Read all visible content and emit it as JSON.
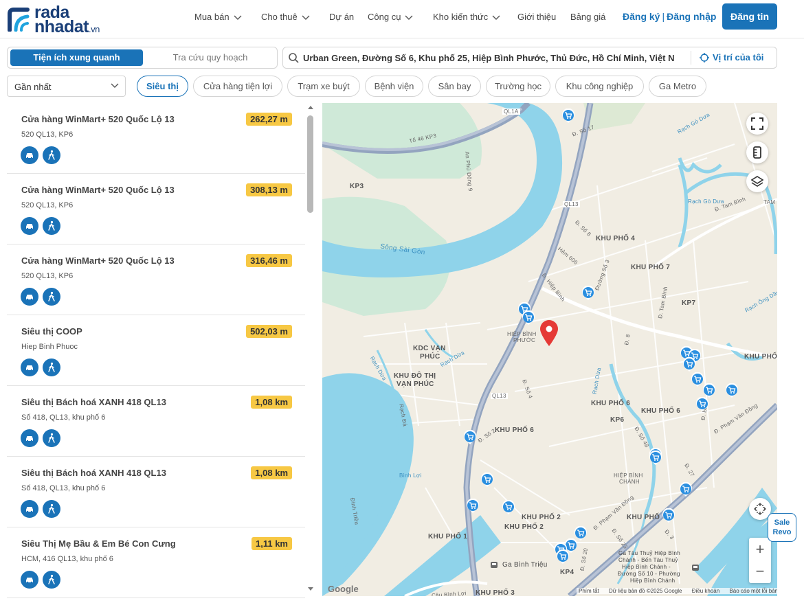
{
  "header": {
    "logo_line1": "rada",
    "logo_line2": "nhadat",
    "logo_suffix": ".vn",
    "nav": [
      "Mua bán",
      "Cho thuê",
      "Dự án",
      "Công cụ",
      "Kho kiến thức",
      "Giới thiệu",
      "Bảng giá"
    ],
    "register": "Đăng ký",
    "login": "Đăng nhập",
    "post_button": "Đăng tin"
  },
  "toolbar": {
    "tab_active": "Tiện ích xung quanh",
    "tab_inactive": "Tra cứu quy hoạch",
    "search_value": "Urban Green, Đường Số 6, Khu phố 25, Hiệp Bình Phước, Thủ Đức, Hồ Chí Minh, Việt N",
    "my_location": "Vị trí của tôi",
    "sort_value": "Gần nhất",
    "categories": [
      "Siêu thị",
      "Cửa hàng tiện lợi",
      "Trạm xe buýt",
      "Bệnh viện",
      "Sân bay",
      "Trường học",
      "Khu công nghiệp",
      "Ga Metro"
    ],
    "active_category": "Siêu thị"
  },
  "places": [
    {
      "name": "Cửa hàng WinMart+ 520 Quốc Lộ 13",
      "address": "520 QL13, KP6",
      "distance": "262,27 m"
    },
    {
      "name": "Cửa hàng WinMart+ 520 Quốc Lộ 13",
      "address": "520 QL13, KP6",
      "distance": "308,13 m"
    },
    {
      "name": "Cửa hàng WinMart+ 520 Quốc Lộ 13",
      "address": "520 QL13, KP6",
      "distance": "316,46 m"
    },
    {
      "name": "Siêu thị COOP",
      "address": "Hiep Binh Phuoc",
      "distance": "502,03 m"
    },
    {
      "name": "Siêu thị Bách hoá XANH 418 QL13",
      "address": "Số 418, QL13, khu phố 6",
      "distance": "1,08 km"
    },
    {
      "name": "Siêu thị Bách hoá XANH 418 QL13",
      "address": "Số 418, QL13, khu phố 6",
      "distance": "1,08 km"
    },
    {
      "name": "Siêu Thị Mẹ Bầu & Em Bé Con Cưng",
      "address": "HCM, 416 QL13, khu phố 6",
      "distance": "1,11 km"
    }
  ],
  "map": {
    "labels": {
      "kp3": "KP3",
      "song_sai_gon": "Sông Sài Gòn",
      "kdc_van_phuc_1": "KDC VẠN",
      "kdc_van_phuc_2": "PHÚC",
      "kdt_van_phuc_1": "KHU ĐÔ THỊ",
      "kdt_van_phuc_2": "VẠN PHÚC",
      "hiep_binh_phuoc_1": "HIỆP BÌNH",
      "hiep_binh_phuoc_2": "PHƯỚC",
      "kp4": "KHU PHỐ 4",
      "kp7": "KHU PHỐ 7",
      "kp7b": "KP7",
      "kp6a": "KHU PHỐ 6",
      "kp6b": "KHU PHỐ 6",
      "kp6c": "KP6",
      "kp6d": "KHU PHỐ 6",
      "kp_right": "KHU PHỐ",
      "kp2a": "KHU PHỐ 2",
      "kp2b": "KHU PHỐ 2",
      "kp1": "KHU PHỐ 1",
      "kp3b": "KHU PHỐ 3",
      "kp4b": "KP4",
      "kp_right2": "KHU PHỐ",
      "hiep_binh_chanh_1": "HIỆP BÌNH",
      "hiep_binh_chanh_2": "CHÁNH",
      "ga_binh_trieu": "Ga Bình Triệu",
      "ga_tau_1": "Ga Tàu Thuỷ Hiệp Bình",
      "ga_tau_2": "Chánh - Bến Tàu Thuỷ",
      "ga_tau_3": "Hiệp Bình Chánh -",
      "ga_tau_4": "Đường Số 10 - Phường",
      "ga_tau_5": "Hiệp Bình Chánh",
      "ql13_a": "QL13",
      "ql13_b": "QL13",
      "ql1a": "QL1A",
      "d_hiep_binh": "Đ. Hiệp Bình",
      "d_pham_van_dong_1": "Đ. Phạm Văn Đồng",
      "d_pham_van_dong_2": "Đ. Phạm Văn Đồng",
      "d_tam_binh": "Đ. Tam Bình",
      "d_tam_binh2": "Đ. Tam Bình",
      "an_phu_dong_9": "An Phú Đông 9",
      "to_46": "Tổ 46 KP3",
      "hem_606": "Hẻm 606",
      "duong_so_3": "Đường Số 3",
      "d_so_17": "Đ. Số 17",
      "d_so_8": "Đ. Số 8",
      "d_so_4": "Đ. Số 4",
      "d_so_2": "Đ. Số 2",
      "d_so_48": "Đ. Số 48",
      "d_so_27": "Đ. 27",
      "d_so_23": "Đ. Số 23",
      "d_so_20": "Đ. Số 20",
      "d_so_3b": "Đ. 3",
      "d_binh": "Đ. Bình",
      "d_8": "Đ. 8",
      "rach_da": "Rạch Đá",
      "rach_dua": "Rạch Dừa",
      "rach_dua2": "Rạch Dừa",
      "rach_dua3": "Rạch Dừa",
      "rach_go_dua": "Rạch Gò Dưa",
      "rach_go_dua2": "Rạch Gò Dưa",
      "rach_ong_dau": "Rạch Ông Dầu",
      "binh_loi": "Bình Lợi",
      "dinh_trieu": "Đình Triều",
      "cau_binh_loi": "Cầu Bình Lợi",
      "tam": "TAM"
    },
    "footer": {
      "shortcuts": "Phím tắt",
      "data": "Dữ liệu bản đồ ©2025 Google",
      "terms": "Điều khoản",
      "report": "Báo cáo một lỗi bản đồ"
    },
    "google": "Google"
  },
  "sale_badge": {
    "line1": "Sale",
    "line2": "Revo"
  },
  "colors": {
    "brand_blue": "#1a73b8",
    "distance_badge": "#f7c844",
    "river": "#8fd3ea",
    "park": "#c6ead3",
    "pin": "#e53935"
  }
}
